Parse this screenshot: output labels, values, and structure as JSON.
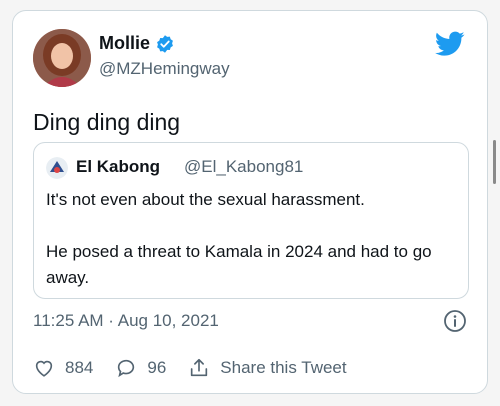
{
  "author": {
    "name": "Mollie",
    "handle": "@MZHemingway",
    "verified": true,
    "avatar_icon": "profile-photo"
  },
  "tweet": {
    "text": "Ding ding ding",
    "timestamp": "11:25 AM · Aug 10, 2021"
  },
  "quoted_tweet": {
    "name": "El Kabong",
    "handle": "@El_Kabong81",
    "avatar_icon": "cartoon-avatar",
    "paragraphs": [
      "It's not even about the sexual harassment.",
      "He posed a threat to Kamala in 2024 and had to go away."
    ]
  },
  "actions": {
    "like_count": "884",
    "reply_count": "96",
    "share_label": "Share this Tweet"
  },
  "colors": {
    "twitter_blue": "#1d9bf0",
    "secondary_text": "#536471",
    "border": "#cfd9de"
  }
}
